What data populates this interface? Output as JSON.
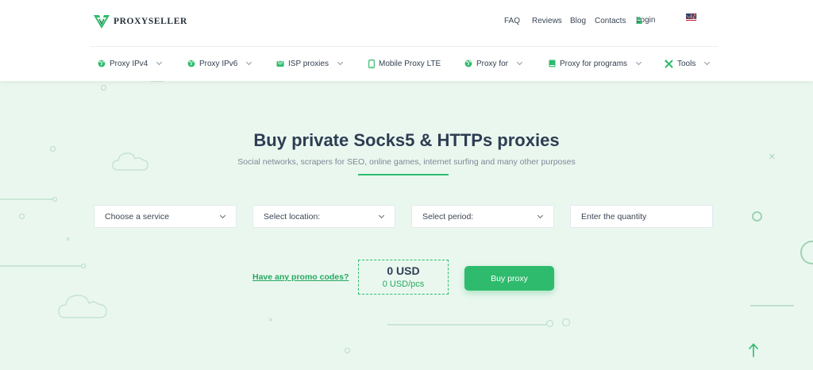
{
  "header": {
    "brand": "PROXYSELLER",
    "top_links": [
      {
        "label": "FAQ",
        "name": "faq-link"
      },
      {
        "label": "Reviews",
        "name": "reviews-link"
      },
      {
        "label": "Blog",
        "name": "blog-link"
      },
      {
        "label": "Contacts",
        "name": "contacts-link"
      }
    ],
    "login_label": "Login",
    "language": "EN",
    "nav": [
      {
        "label": "Proxy IPv4",
        "icon": "globe-icon",
        "dropdown": true
      },
      {
        "label": "Proxy IPv6",
        "icon": "globe-icon",
        "dropdown": true
      },
      {
        "label": "ISP proxies",
        "icon": "map-icon",
        "dropdown": true
      },
      {
        "label": "Mobile Proxy LTE",
        "icon": "phone-icon",
        "dropdown": false
      },
      {
        "label": "Proxy for",
        "icon": "globe-icon",
        "dropdown": true
      },
      {
        "label": "Proxy for programs",
        "icon": "book-icon",
        "dropdown": true
      },
      {
        "label": "Tools",
        "icon": "tools-icon",
        "dropdown": true
      }
    ]
  },
  "hero": {
    "title": "Buy private Socks5 & HTTPs proxies",
    "subtitle": "Social networks, scrapers for SEO, online games, internet surfing and many other purposes"
  },
  "form": {
    "service": "Choose a service",
    "location": "Select location:",
    "period": "Select period:",
    "quantity_placeholder": "Enter the quantity"
  },
  "order": {
    "promo_label": "Have any promo codes?",
    "total": "0 USD",
    "unit_price": "0 USD/pcs",
    "buy_label": "Buy proxy"
  },
  "colors": {
    "accent": "#2fbb6d",
    "background": "#eaf7ef",
    "title": "#2d3d52"
  }
}
